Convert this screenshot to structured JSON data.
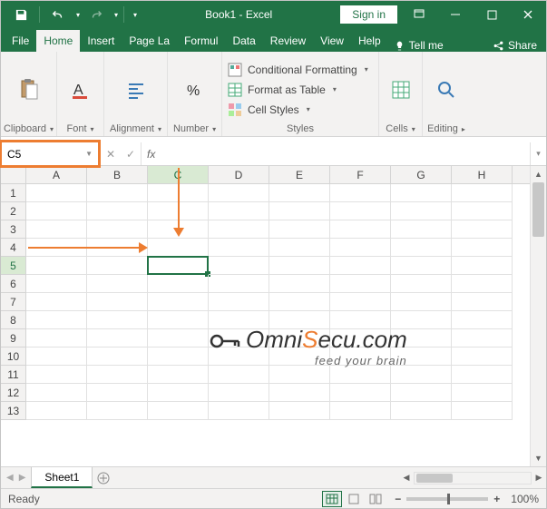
{
  "titlebar": {
    "title": "Book1 - Excel",
    "sign_in": "Sign in"
  },
  "tabs": {
    "file": "File",
    "home": "Home",
    "insert": "Insert",
    "page_layout": "Page La",
    "formulas": "Formul",
    "data": "Data",
    "review": "Review",
    "view": "View",
    "help": "Help",
    "tell_me": "Tell me",
    "share": "Share"
  },
  "ribbon": {
    "clipboard": "Clipboard",
    "font": "Font",
    "alignment": "Alignment",
    "number": "Number",
    "cond_fmt": "Conditional Formatting",
    "fmt_table": "Format as Table",
    "cell_styles": "Cell Styles",
    "styles": "Styles",
    "cells": "Cells",
    "editing": "Editing"
  },
  "formula_bar": {
    "namebox": "C5",
    "fx": "fx"
  },
  "grid": {
    "columns": [
      "A",
      "B",
      "C",
      "D",
      "E",
      "F",
      "G",
      "H"
    ],
    "rows": [
      1,
      2,
      3,
      4,
      5,
      6,
      7,
      8,
      9,
      10,
      11,
      12,
      13
    ],
    "selected_col": "C",
    "selected_row": 5
  },
  "watermark": {
    "prefix": "O",
    "mid": "mni",
    "accent": "S",
    "rest": "ecu.com",
    "sub": "feed your brain"
  },
  "sheet": {
    "tab": "Sheet1"
  },
  "status": {
    "ready": "Ready",
    "zoom": "100%"
  }
}
